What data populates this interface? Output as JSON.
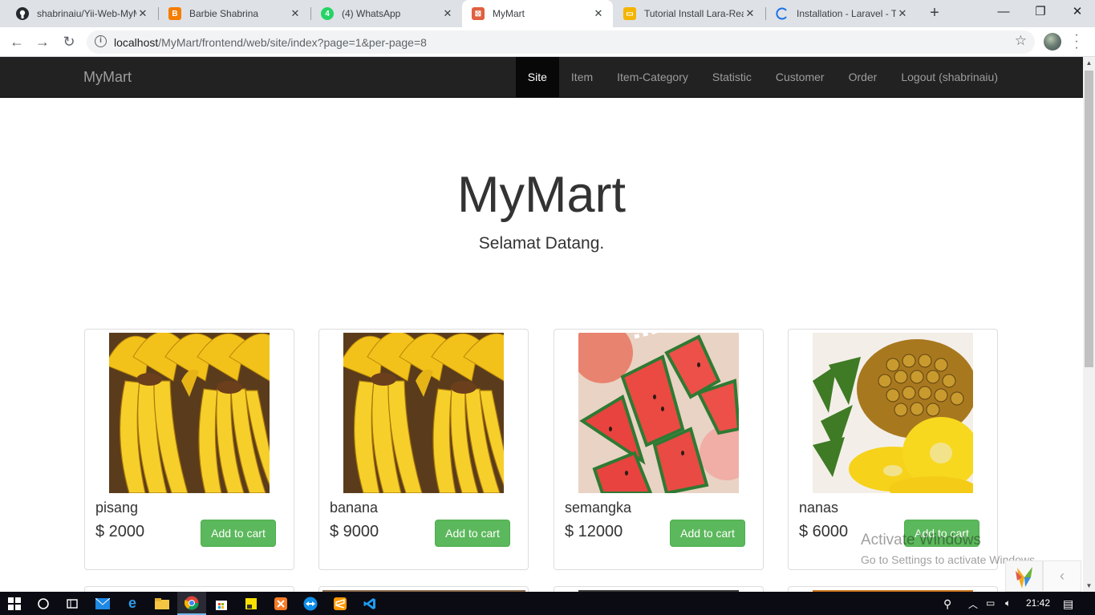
{
  "browser": {
    "tabs": [
      {
        "title": "shabrinaiu/Yii-Web-MyM",
        "icon": "github-icon",
        "color": "#24292e"
      },
      {
        "title": "Barbie Shabrina",
        "icon": "blogger-icon",
        "color": "#f57d00"
      },
      {
        "title": "(4) WhatsApp",
        "icon": "whatsapp-icon",
        "color": "#25d366"
      },
      {
        "title": "MyMart",
        "icon": "xampp-icon",
        "color": "#e0603f",
        "active": true
      },
      {
        "title": "Tutorial Install Lara-Rea",
        "icon": "slides-icon",
        "color": "#f4b400"
      },
      {
        "title": "Installation - Laravel - T",
        "icon": "loading-icon",
        "color": "#1a73e8"
      }
    ],
    "new_tab_label": "+",
    "address": {
      "host": "localhost",
      "path": "/MyMart/frontend/web/site/index?page=1&per-page=8"
    }
  },
  "navbar": {
    "brand": "MyMart",
    "items": [
      {
        "label": "Site",
        "active": true
      },
      {
        "label": "Item"
      },
      {
        "label": "Item-Category"
      },
      {
        "label": "Statistic"
      },
      {
        "label": "Customer"
      },
      {
        "label": "Order"
      },
      {
        "label": "Logout (shabrinaiu)"
      }
    ]
  },
  "jumbotron": {
    "title": "MyMart",
    "subtitle": "Selamat Datang."
  },
  "products": [
    {
      "name": "pisang",
      "price": "$ 2000",
      "button": "Add to cart",
      "image": "banana-image"
    },
    {
      "name": "banana",
      "price": "$ 9000",
      "button": "Add to cart",
      "image": "banana-image"
    },
    {
      "name": "semangka",
      "price": "$ 12000",
      "button": "Add to cart",
      "image": "watermelon-image"
    },
    {
      "name": "nanas",
      "price": "$ 6000",
      "button": "Add to cart",
      "image": "pineapple-image"
    }
  ],
  "watermark": {
    "line1": "Activate Windows",
    "line2": "Go to Settings to activate Windows."
  },
  "taskbar": {
    "time": "21:42"
  }
}
